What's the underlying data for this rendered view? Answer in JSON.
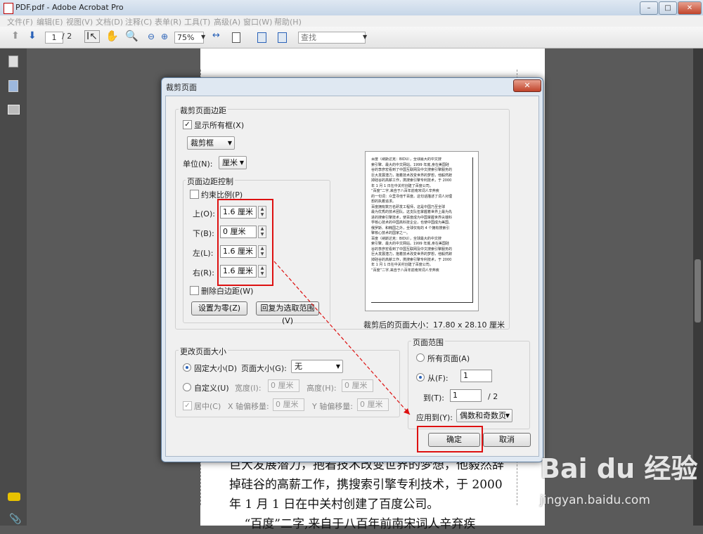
{
  "window": {
    "title": "PDF.pdf - Adobe Acrobat Pro",
    "controls": {
      "minimize": "–",
      "maximize": "□",
      "close": "✕"
    }
  },
  "menubar": {
    "items": [
      "文件(F)",
      "编辑(E)",
      "视图(V)",
      "文档(D)",
      "注释(C)",
      "表单(R)",
      "工具(T)",
      "高级(A)",
      "窗口(W)",
      "帮助(H)"
    ]
  },
  "toolbar": {
    "current_page": "1",
    "total_pages": "/ 2",
    "zoom": "75%",
    "find_placeholder": "查找"
  },
  "page": {
    "lines": [
      "巨大发展潜力，抱着技术改变世界的梦想，他毅然辞",
      "掉硅谷的高薪工作，携搜索引擎专利技术，于 2000",
      "年 1 月 1 日在中关村创建了百度公司。",
      "    “百度”二字,来自于八百年前南宋词人辛弃疾"
    ]
  },
  "dialog": {
    "title": "裁剪页面",
    "close": "✕",
    "crop_margins": {
      "group_label": "裁剪页面边距",
      "show_all_boxes": "显示所有框(X)",
      "show_all_boxes_checked": true,
      "box_type": "裁剪框",
      "units_label": "单位(N):",
      "units_value": "厘米",
      "margin_controls": {
        "group_label": "页面边距控制",
        "constrain_label": "约束比例(P)",
        "constrain_checked": false,
        "top_label": "上(O):",
        "top_value": "1.6 厘米",
        "bottom_label": "下(B):",
        "bottom_value": "0 厘米",
        "left_label": "左(L):",
        "left_value": "1.6 厘米",
        "right_label": "右(R):",
        "right_value": "1.6 厘米",
        "remove_white_label": "删除白边距(W)",
        "remove_white_checked": false,
        "set_zero_button": "设置为零(Z)",
        "revert_button": "回复为选取范围(V)"
      },
      "preview_lines": [
        "百度（纳斯达克：BIDU），全球最大的中文搜",
        "索引擎、最大的中文网站。1999 年底,身在美国硅",
        "谷的李彦宏看到了中国互联网及中文搜索引擎服务的",
        "巨大发展潜力，抱着技术改变世界的梦想，他毅然辞",
        "掉硅谷的高薪工作，携搜索引擎专利技术，于 2000",
        "年 1 月 1 日在中关村创建了百度公司。",
        "“百度”二字,来自于八百年前南宋词人辛弃疾",
        "的一句词：众里寻他千百度。这句话描述了词人对理",
        "想的执着追求。",
        "百度拥有数万名研发工程师，这是中国乃至全球",
        "最为优秀的技术团队。这支队伍掌握着世界上最为先",
        "进的搜索引擎技术，使百度成为中国掌握世界尖端科",
        "学核心技术的中国高科技企业，也使中国成为美国、",
        "俄罗斯、和韩国之外，全球仅有的 4 个拥有搜索引",
        "擎核心技术的国家之一。",
        "百度（纳斯达克：BIDU），全球最大的中文搜",
        "索引擎、最大的中文网站。1999 年底,身在美国硅",
        "谷的李彦宏看到了中国互联网及中文搜索引擎服务的",
        "巨大发展潜力，抱着技术改变世界的梦想，他毅然辞",
        "掉硅谷的高薪工作，携搜索引擎专利技术，于 2000",
        "年 1 月 1 日在中关村创建了百度公司。",
        "“百度”二字,来自于八百年前南宋词人辛弃疾"
      ],
      "cropped_size": "裁剪后的页面大小：17.80 x 28.10 厘米"
    },
    "change_page_size": {
      "group_label": "更改页面大小",
      "fixed_label": "固定大小(D)",
      "fixed_checked": true,
      "page_size_label": "页面大小(G):",
      "page_size_value": "无",
      "custom_label": "自定义(U)",
      "custom_checked": false,
      "width_label": "宽度(I):",
      "width_value": "0 厘米",
      "height_label": "高度(H):",
      "height_value": "0 厘米",
      "center_label": "居中(C)",
      "center_checked": true,
      "x_offset_label": "X 轴偏移量:",
      "x_offset_value": "0 厘米",
      "y_offset_label": "Y 轴偏移量:",
      "y_offset_value": "0 厘米"
    },
    "page_range": {
      "group_label": "页面范围",
      "all_label": "所有页面(A)",
      "all_checked": false,
      "from_label": "从(F):",
      "from_checked": true,
      "from_value": "1",
      "to_label": "到(T):",
      "to_value": "1",
      "to_total": "/ 2",
      "apply_to_label": "应用到(Y):",
      "apply_to_value": "偶数和奇数页"
    },
    "ok_button": "确定",
    "cancel_button": "取消"
  },
  "watermark": {
    "brand_text": "Bai du 经验",
    "url": "jingyan.baidu.com"
  },
  "colors": {
    "highlight_red": "#dd1111",
    "accent_blue": "#2a62b8"
  }
}
